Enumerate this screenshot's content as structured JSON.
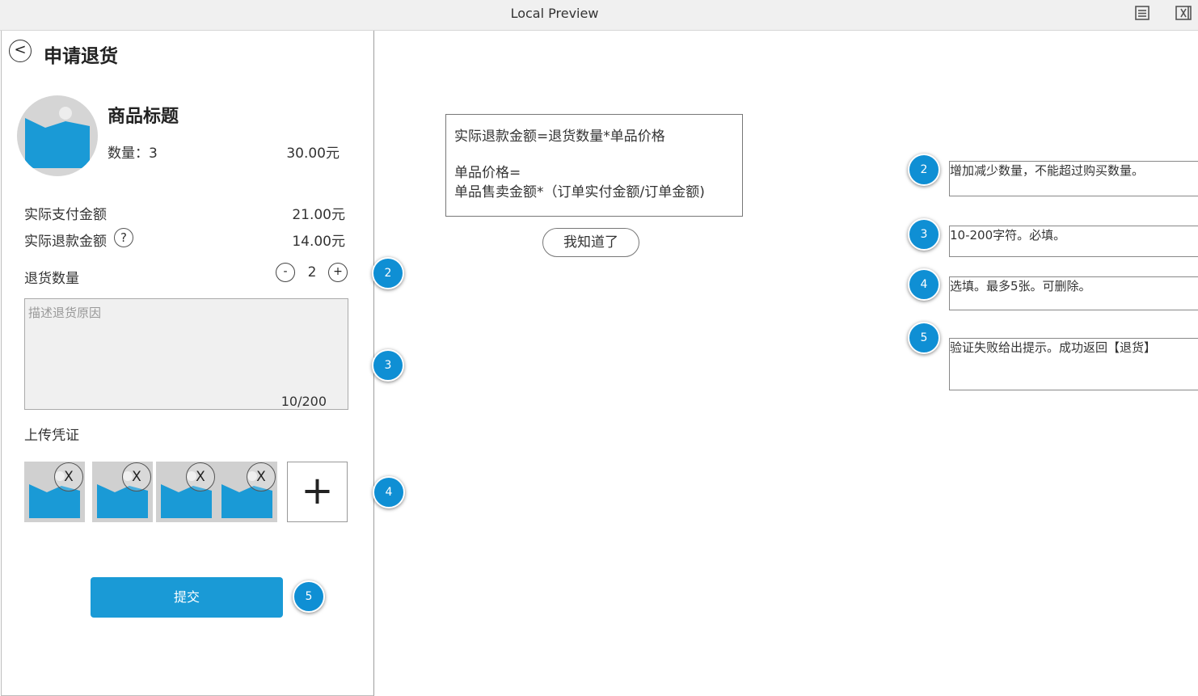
{
  "window": {
    "title": "Local Preview",
    "icons": [
      "list-icon",
      "close-panel-icon"
    ]
  },
  "page": {
    "back_symbol": "<",
    "title": "申请退货"
  },
  "product": {
    "title": "商品标题",
    "qty_label": "数量：3",
    "price": "30.00元"
  },
  "amounts": {
    "paid_label": "实际支付金额",
    "paid_value": "21.00元",
    "refund_label": "实际退款金额",
    "refund_value": "14.00元",
    "help_symbol": "?"
  },
  "return_qty": {
    "label": "退货数量",
    "minus": "-",
    "value": "2",
    "plus": "+"
  },
  "reason": {
    "placeholder": "描述退货原因",
    "counter": "10/200"
  },
  "upload": {
    "label": "上传凭证",
    "delete_symbol": "X",
    "add_symbol": "+",
    "images": [
      1,
      2,
      3,
      4
    ]
  },
  "submit_label": "提交",
  "markers": {
    "m2": "2",
    "m3": "3",
    "m4": "4",
    "m5": "5"
  },
  "popup": {
    "line1": "实际退款金额=退货数量*单品价格",
    "line2": "单品价格=",
    "line3": "单品售卖金额*（订单实付金额/订单金额)",
    "button": "我知道了"
  },
  "notes": {
    "n2": "增加减少数量，不能超过购买数量。",
    "n3": "10-200字符。必填。",
    "n4": "选填。最多5张。可删除。",
    "n5": "验证失败给出提示。成功返回【退货】"
  },
  "colors": {
    "accent": "#1a9ad6",
    "marker": "#0f8fd4",
    "image_placeholder": "#1a9ad6"
  }
}
